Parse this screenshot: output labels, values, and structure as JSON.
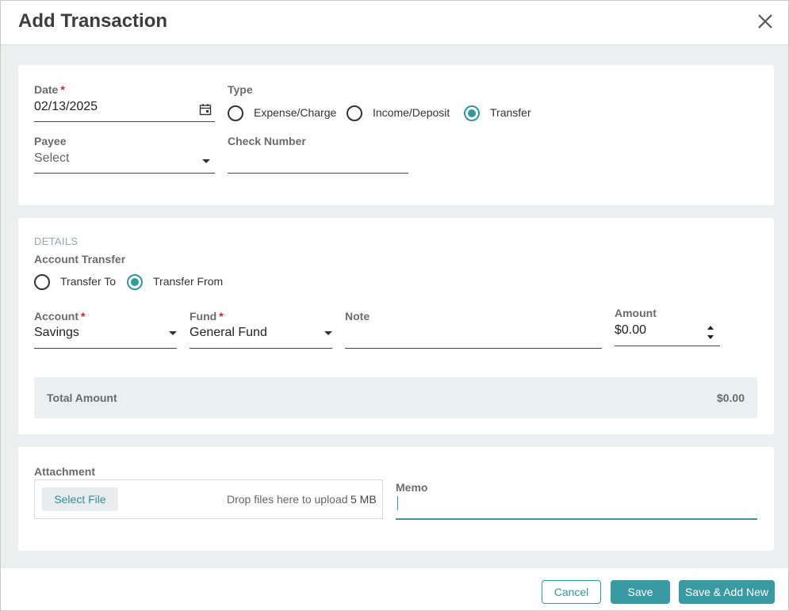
{
  "dialog": {
    "title": "Add Transaction"
  },
  "top": {
    "date": {
      "label": "Date",
      "required_mark": "*",
      "value": "02/13/2025"
    },
    "type": {
      "label": "Type",
      "options": [
        "Expense/Charge",
        "Income/Deposit",
        "Transfer"
      ],
      "selected": "Transfer"
    },
    "payee": {
      "label": "Payee",
      "placeholder": "Select"
    },
    "check_number": {
      "label": "Check Number",
      "value": ""
    }
  },
  "details": {
    "heading": "DETAILS",
    "account_transfer": {
      "label": "Account Transfer",
      "options": [
        "Transfer To",
        "Transfer From"
      ],
      "selected": "Transfer From"
    },
    "account": {
      "label": "Account",
      "required_mark": "*",
      "value": "Savings"
    },
    "fund": {
      "label": "Fund",
      "required_mark": "*",
      "value": "General Fund"
    },
    "note": {
      "label": "Note",
      "value": ""
    },
    "amount": {
      "label": "Amount",
      "value": "$0.00"
    },
    "total": {
      "label": "Total Amount",
      "value": "$0.00"
    }
  },
  "attachment": {
    "label": "Attachment",
    "select_file": "Select File",
    "drop_text": "Drop files here to upload",
    "max_size": "5 MB"
  },
  "memo": {
    "label": "Memo",
    "value": ""
  },
  "footer": {
    "cancel": "Cancel",
    "save": "Save",
    "save_add_new": "Save & Add New"
  },
  "colors": {
    "accent": "#2e9a9a",
    "required": "#c62828",
    "background": "#eceff0"
  },
  "icons": [
    "close-icon",
    "calendar-icon",
    "dropdown-caret-icon",
    "spinner-arrows-icon"
  ]
}
